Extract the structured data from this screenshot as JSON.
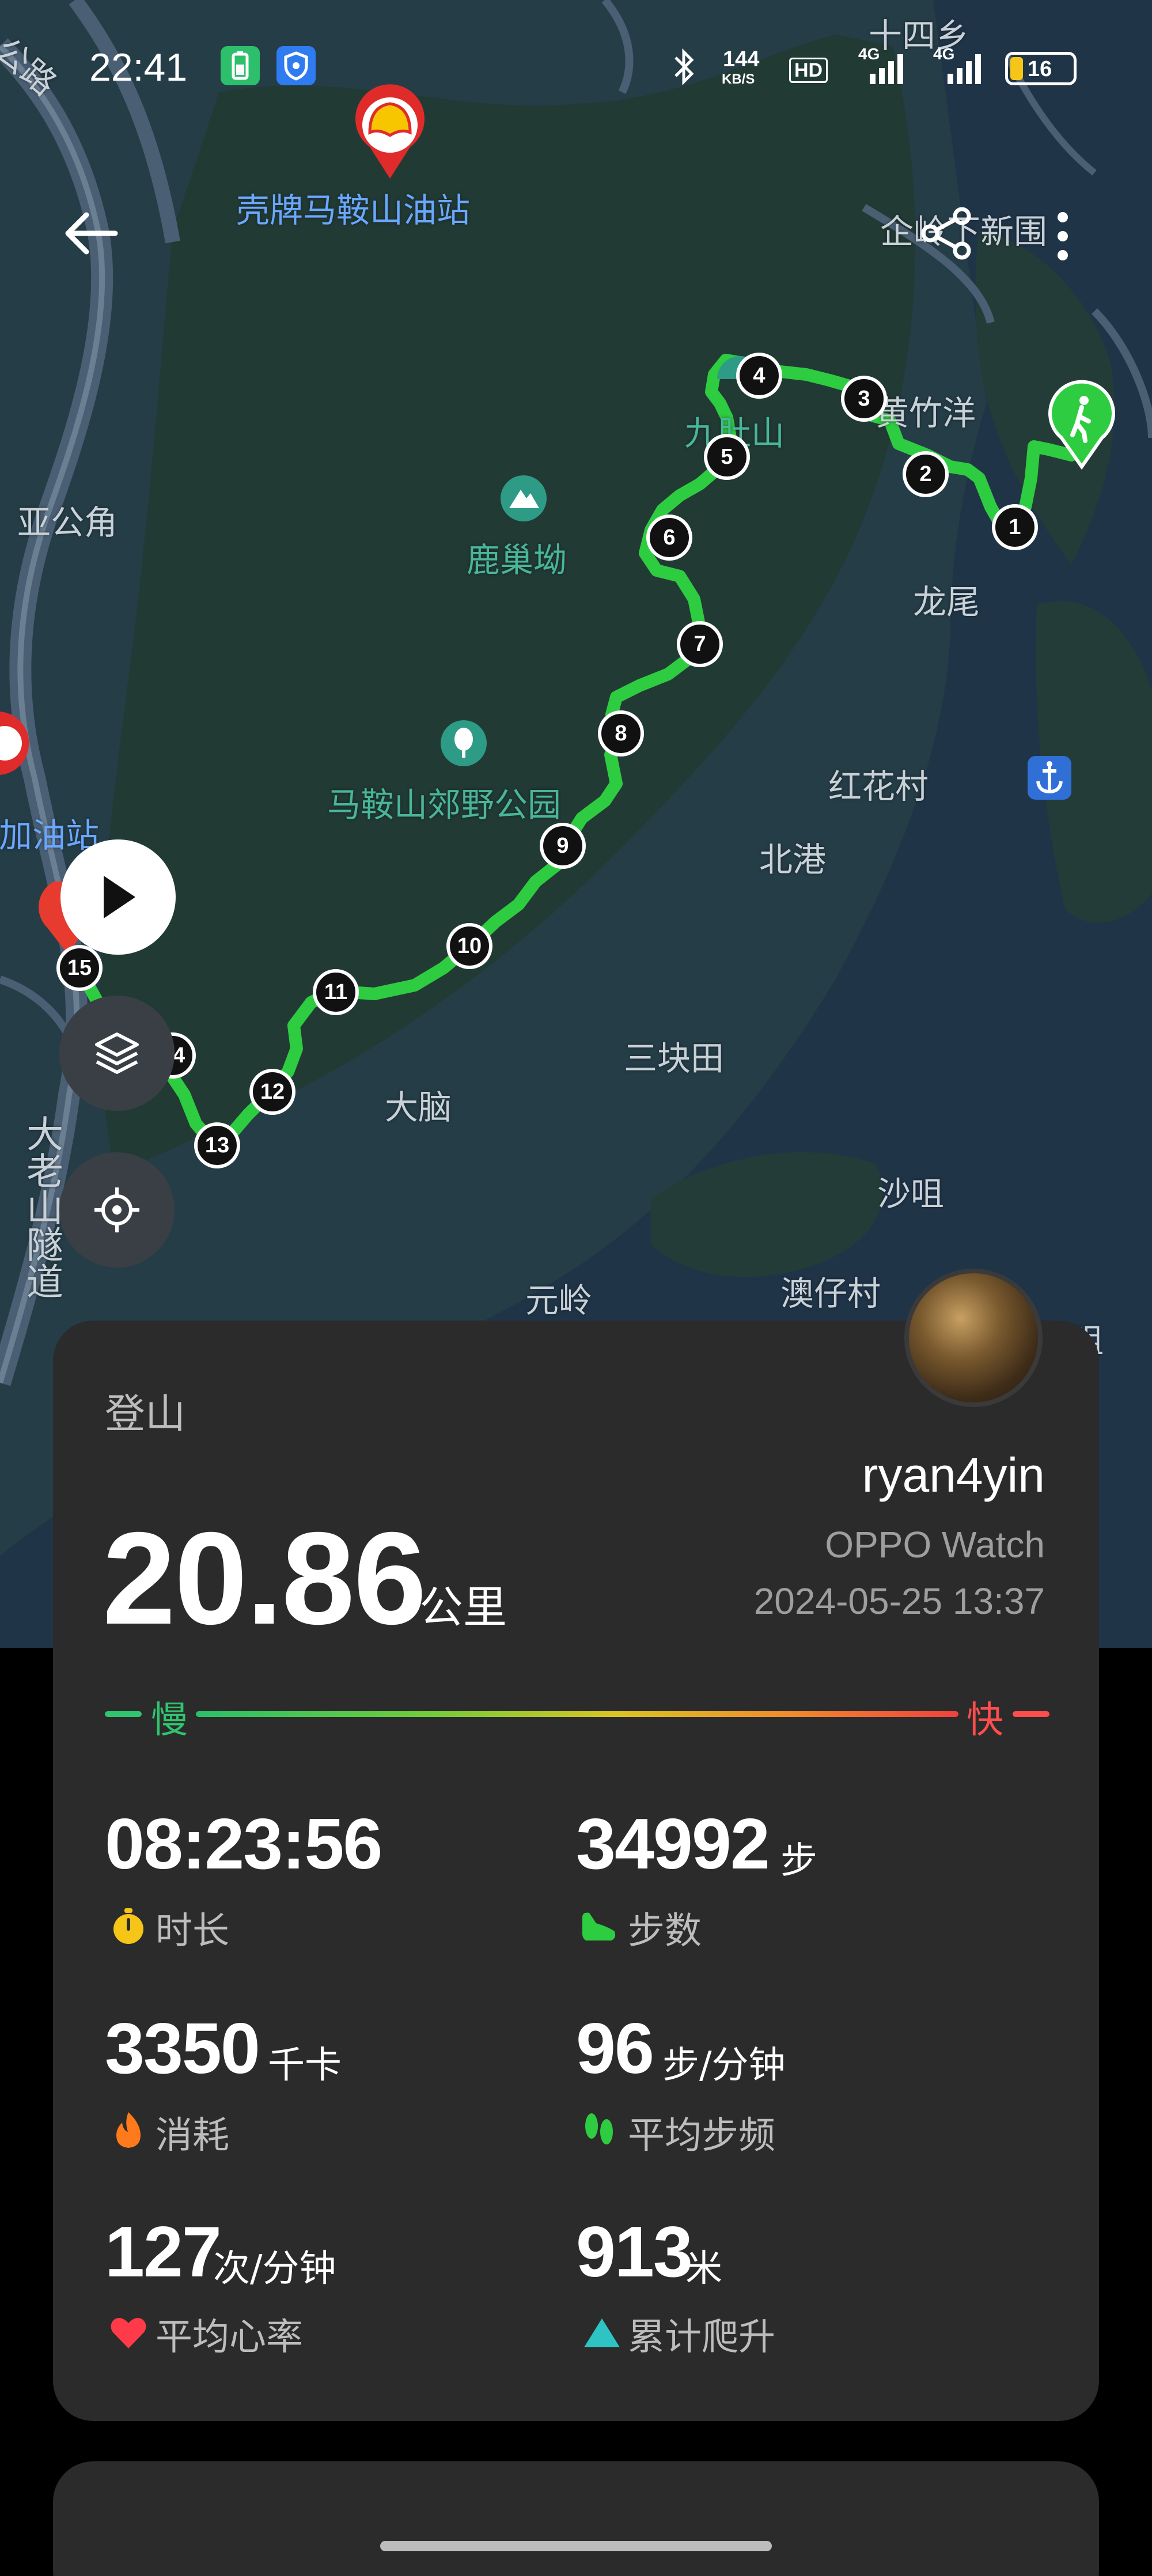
{
  "status_bar": {
    "time": "22:41",
    "network_speed": "144",
    "network_speed_unit": "KB/S",
    "hd_label": "HD",
    "sim1": "4G",
    "sim2": "4G",
    "battery": "16",
    "icons": [
      "battery-app-icon",
      "shield-app-icon",
      "bluetooth-icon",
      "signal-icon",
      "battery-icon"
    ]
  },
  "map": {
    "labels": {
      "gas_station_top": "壳牌马鞍山油站",
      "gas_station_left": "北加油站",
      "shisixiang": "十四乡",
      "qilingxia": "企岭下新围",
      "yagongjiao": "亚公角",
      "luchaoao": "鹿巢坳",
      "jiushan": "九肚山",
      "zhuyang": "黄竹洋",
      "longwei": "龙尾",
      "maanshan_park": "马鞍山郊野公园",
      "honghuacun": "红花村",
      "beigang": "北港",
      "sankuaitian": "三块田",
      "danao": "大脑",
      "shaju": "沙咀",
      "yuanling": "元岭",
      "aozaicun": "澳仔村",
      "tunnel": "大老山隧道",
      "road_top_left": "公路",
      "sanzui_right": "三咀"
    },
    "km_markers": [
      "1",
      "2",
      "3",
      "4",
      "5",
      "6",
      "7",
      "8",
      "9",
      "10",
      "11",
      "12",
      "13",
      "14",
      "15"
    ],
    "route_color": "#2ecc40"
  },
  "stats": {
    "activity_type": "登山",
    "username": "ryan4yin",
    "device": "OPPO Watch",
    "datetime": "2024-05-25 13:37",
    "distance": "20.86",
    "distance_unit": "公里",
    "pace_slow": "慢",
    "pace_fast": "快",
    "duration": "08:23:56",
    "duration_label": "时长",
    "steps": "34992",
    "steps_unit": "步",
    "steps_label": "步数",
    "calories": "3350",
    "calories_unit": "千卡",
    "calories_label": "消耗",
    "cadence": "96",
    "cadence_unit": "步/分钟",
    "cadence_label": "平均步频",
    "heart_rate": "127",
    "heart_rate_unit": "次/分钟",
    "heart_rate_label": "平均心率",
    "ascent": "913",
    "ascent_unit": "米",
    "ascent_label": "累计爬升"
  },
  "colors": {
    "card_bg": "#2b2b2b",
    "route_green": "#2ecc40",
    "pace_slow": "#31c46f",
    "pace_fast": "#ff4d4d",
    "timer_icon": "#f5c518",
    "steps_icon": "#2ecc40",
    "fire_icon": "#ff7a1a",
    "heart_icon": "#ff3b4a",
    "ascent_icon": "#2ec4c4"
  }
}
